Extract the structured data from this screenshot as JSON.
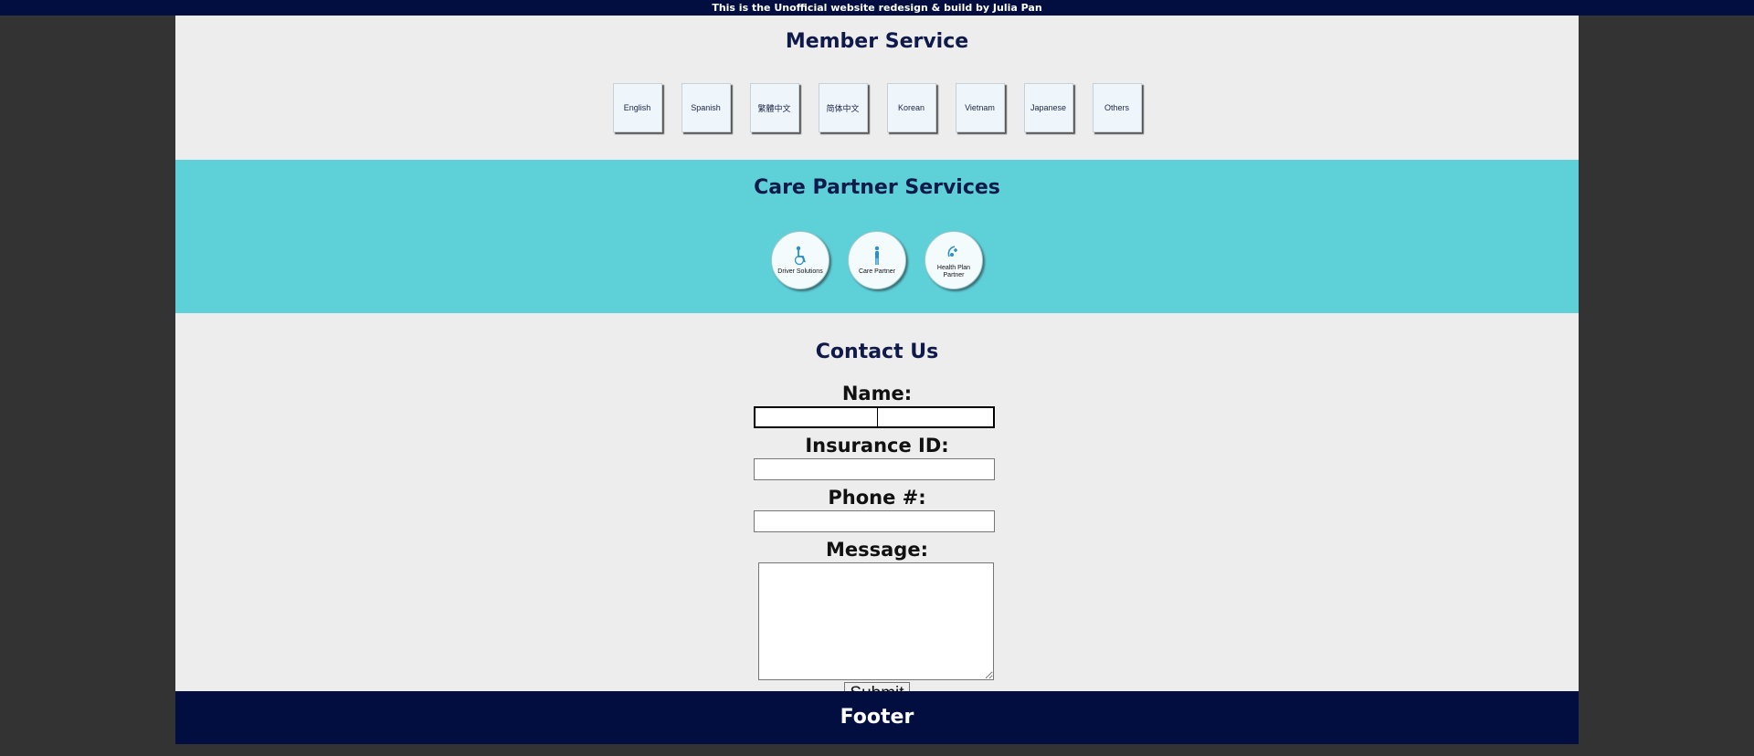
{
  "topbar": {
    "text": "This is the Unofficial website redesign & build by Julia Pan"
  },
  "member_service": {
    "title": "Member Service",
    "languages": [
      "English",
      "Spanish",
      "繁體中文",
      "简体中文",
      "Korean",
      "Vietnam",
      "Japanese",
      "Others"
    ]
  },
  "care_partner": {
    "title": "Care Partner Services",
    "items": [
      {
        "label": "Driver Solutions",
        "icon": "wheelchair-icon"
      },
      {
        "label": "Care Partner",
        "icon": "person-icon"
      },
      {
        "label": "Health Plan Partner",
        "icon": "health-partner-icon"
      }
    ]
  },
  "contact": {
    "title": "Contact Us",
    "name_label": "Name:",
    "insurance_label": "Insurance ID:",
    "phone_label": "Phone #:",
    "message_label": "Message:",
    "submit_label": "Submit"
  },
  "footer": {
    "text": "Footer"
  },
  "colors": {
    "navy": "#010e3f",
    "teal": "#5ed0d8",
    "light_gray": "#ededed",
    "dark_bg": "#333333"
  }
}
